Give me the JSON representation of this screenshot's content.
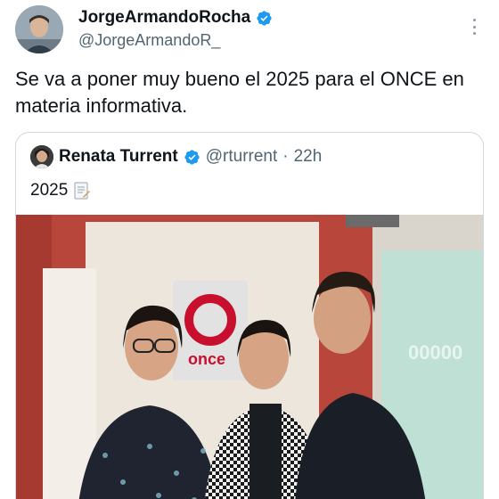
{
  "tweet": {
    "author_name": "JorgeArmandoRocha",
    "author_handle": "@JorgeArmandoR_",
    "text": "Se va a poner muy bueno el 2025 para el ONCE en materia informativa."
  },
  "quoted_tweet": {
    "author_name": "Renata Turrent",
    "author_handle": "@rturrent",
    "separator": "·",
    "time": "22h",
    "text": "2025"
  },
  "photo": {
    "logo_text": "once",
    "wall_text": "00000"
  },
  "icons": {
    "verified": "verified-badge-icon",
    "more": "more-options-icon",
    "memo": "memo-icon"
  },
  "colors": {
    "verified_blue": "#1d9bf0",
    "text_primary": "#0f1419",
    "text_secondary": "#536471",
    "border": "#cfd9de",
    "once_red": "#c8102e"
  }
}
